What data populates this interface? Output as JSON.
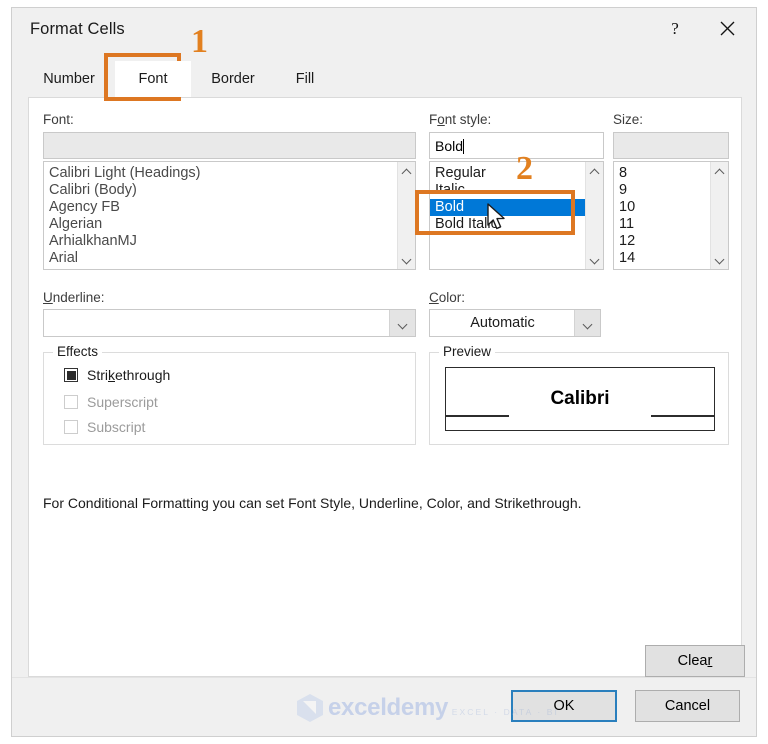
{
  "window": {
    "title": "Format Cells",
    "help_icon": "help-question-icon",
    "help_glyph": "?",
    "close_icon": "close-x-icon"
  },
  "tabs": [
    {
      "id": "number",
      "label": "Number",
      "active": false
    },
    {
      "id": "font",
      "label": "Font",
      "active": true
    },
    {
      "id": "border",
      "label": "Border",
      "active": false
    },
    {
      "id": "fill",
      "label": "Fill",
      "active": false
    }
  ],
  "font_section": {
    "label": "Font:",
    "input_value": "",
    "items": [
      "Calibri Light (Headings)",
      "Calibri (Body)",
      "Agency FB",
      "Algerian",
      "ArhialkhanMJ",
      "Arial"
    ]
  },
  "font_style_section": {
    "label_pre": "F",
    "label_accel": "o",
    "label_post": "nt style:",
    "input_value": "Bold",
    "items": [
      "Regular",
      "Italic",
      "Bold",
      "Bold Italic"
    ],
    "selected": "Bold"
  },
  "size_section": {
    "label": "Size:",
    "input_value": "",
    "items": [
      "8",
      "9",
      "10",
      "11",
      "12",
      "14"
    ]
  },
  "underline_section": {
    "label_accel": "U",
    "label_post": "nderline:",
    "value": ""
  },
  "color_section": {
    "label_accel": "C",
    "label_post": "olor:",
    "value": "Automatic"
  },
  "effects_section": {
    "title": "Effects",
    "items": [
      {
        "label_pre": "Stri",
        "label_accel": "k",
        "label_post": "ethrough",
        "state": "mixed",
        "disabled": false
      },
      {
        "label_pre": "Su",
        "label_accel": "p",
        "label_post": "erscript",
        "state": "unchecked",
        "disabled": true
      },
      {
        "label_pre": "Su",
        "label_accel": "b",
        "label_post": "script",
        "state": "unchecked",
        "disabled": true
      }
    ]
  },
  "preview_section": {
    "title": "Preview",
    "sample_text": "Calibri"
  },
  "note": "For Conditional Formatting you can set Font Style, Underline, Color, and Strikethrough.",
  "buttons": {
    "clear_pre": "Clea",
    "clear_accel": "r",
    "ok": "OK",
    "cancel": "Cancel"
  },
  "watermark": {
    "name": "exceldemy",
    "tagline": "EXCEL · DATA · BI"
  },
  "annotations": [
    {
      "number": "1",
      "target": "font-tab"
    },
    {
      "number": "2",
      "target": "font-style-list"
    }
  ],
  "colors": {
    "accent_orange": "#dd7722",
    "selection_blue": "#0078d7",
    "focus_blue": "#2a7fbd",
    "dialog_bg": "#f0f0f0"
  }
}
